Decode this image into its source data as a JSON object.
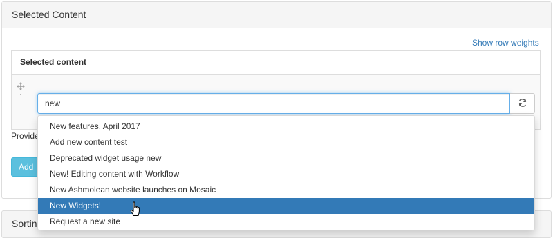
{
  "panel": {
    "title": "Selected Content",
    "show_row_weights": "Show row weights",
    "table_header": "Selected content",
    "search_value": "new",
    "provider_label": "Provide",
    "add_label": "Add"
  },
  "panel2": {
    "title": "Sorting"
  },
  "dropdown": {
    "items": [
      "New features, April 2017",
      "Add new content test",
      "Deprecated widget usage new",
      "New! Editing content with Workflow",
      "New Ashmolean website launches on Mosaic",
      "New Widgets!",
      "Request a new site"
    ],
    "active_index": 5
  },
  "icons": {
    "drag": "move-icon",
    "refresh": "refresh-icon",
    "cursor": "hand-pointer-icon"
  },
  "colors": {
    "link": "#337ab7",
    "active_bg": "#337ab7",
    "add_button": "#5bc0de",
    "focus_border": "#66afe9"
  }
}
